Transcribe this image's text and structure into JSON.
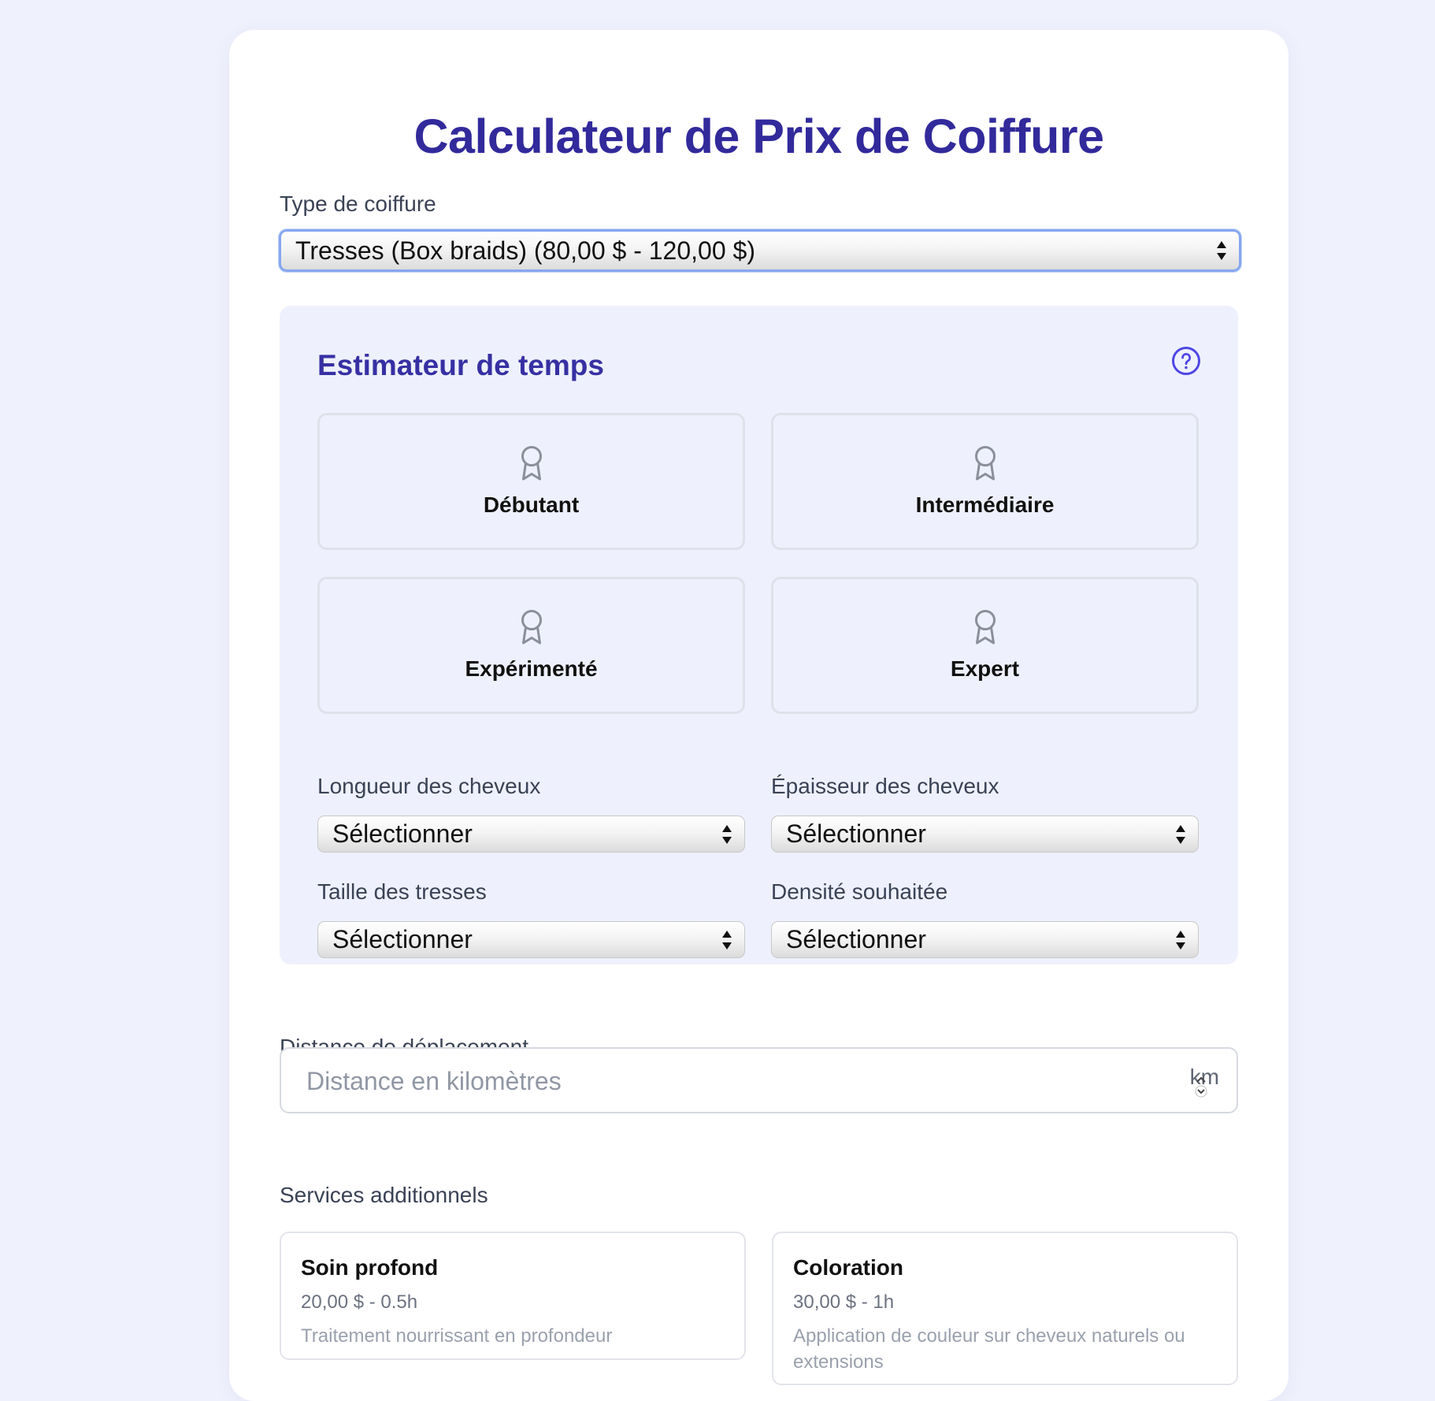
{
  "title": "Calculateur de Prix de Coiffure",
  "hairstyle": {
    "label": "Type de coiffure",
    "selected": "Tresses (Box braids) (80,00 $ - 120,00 $)"
  },
  "estimator": {
    "title": "Estimateur de temps",
    "levels": [
      "Débutant",
      "Intermédiaire",
      "Expérimenté",
      "Expert"
    ],
    "fields": [
      {
        "label": "Longueur des cheveux",
        "selected": "Sélectionner"
      },
      {
        "label": "Épaisseur des cheveux",
        "selected": "Sélectionner"
      },
      {
        "label": "Taille des tresses",
        "selected": "Sélectionner"
      },
      {
        "label": "Densité souhaitée",
        "selected": "Sélectionner"
      }
    ]
  },
  "distance": {
    "label": "Distance de déplacement",
    "placeholder": "Distance en kilomètres",
    "unit": "km"
  },
  "services": {
    "label": "Services additionnels",
    "items": [
      {
        "name": "Soin profond",
        "price": "20,00 $ - 0.5h",
        "description": "Traitement nourrissant en profondeur"
      },
      {
        "name": "Coloration",
        "price": "30,00 $ - 1h",
        "description": "Application de couleur sur cheveux naturels ou extensions"
      }
    ]
  },
  "colors": {
    "primary": "#322a9b",
    "accent": "#4f46e5",
    "panel": "#eef1fd",
    "background": "#eff1fd"
  }
}
